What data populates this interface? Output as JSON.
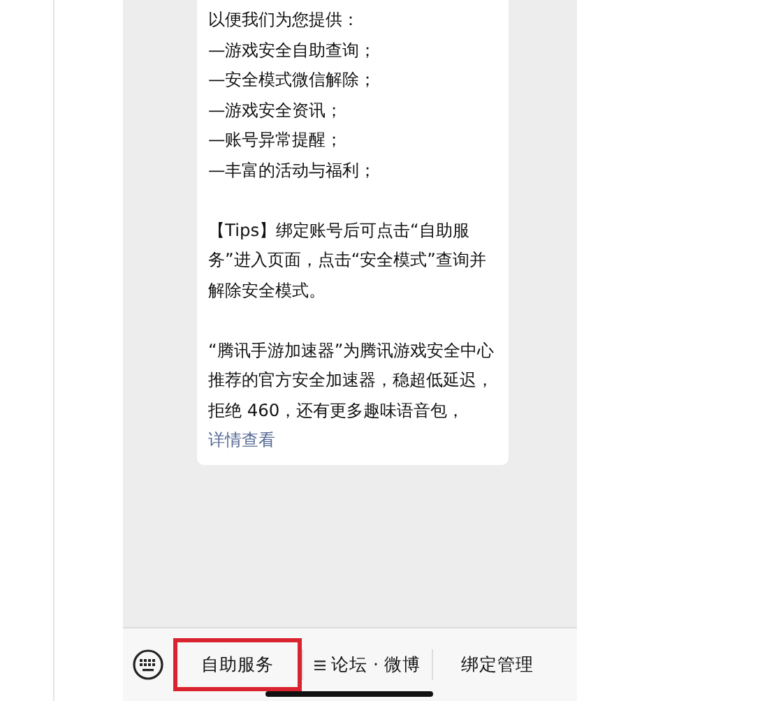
{
  "message": {
    "intro": "以便我们为您提供：",
    "features": [
      "—游戏安全自助查询；",
      "—安全模式微信解除；",
      "—游戏安全资讯；",
      "—账号异常提醒；",
      "—丰富的活动与福利；"
    ],
    "tips": "【Tips】绑定账号后可点击“自助服务”进入页面，点击“安全模式”查询并解除安全模式。",
    "promo": "“腾讯手游加速器”为腾讯游戏安全中心推荐的官方安全加速器，稳超低延迟，拒绝 460，还有更多趣味语音包，",
    "link": "详情查看"
  },
  "menu": [
    {
      "label": "自助服务",
      "has_list_icon": false,
      "highlighted": true
    },
    {
      "label": "论坛 · 微博",
      "has_list_icon": true,
      "highlighted": false
    },
    {
      "label": "绑定管理",
      "has_list_icon": false,
      "highlighted": false
    }
  ]
}
